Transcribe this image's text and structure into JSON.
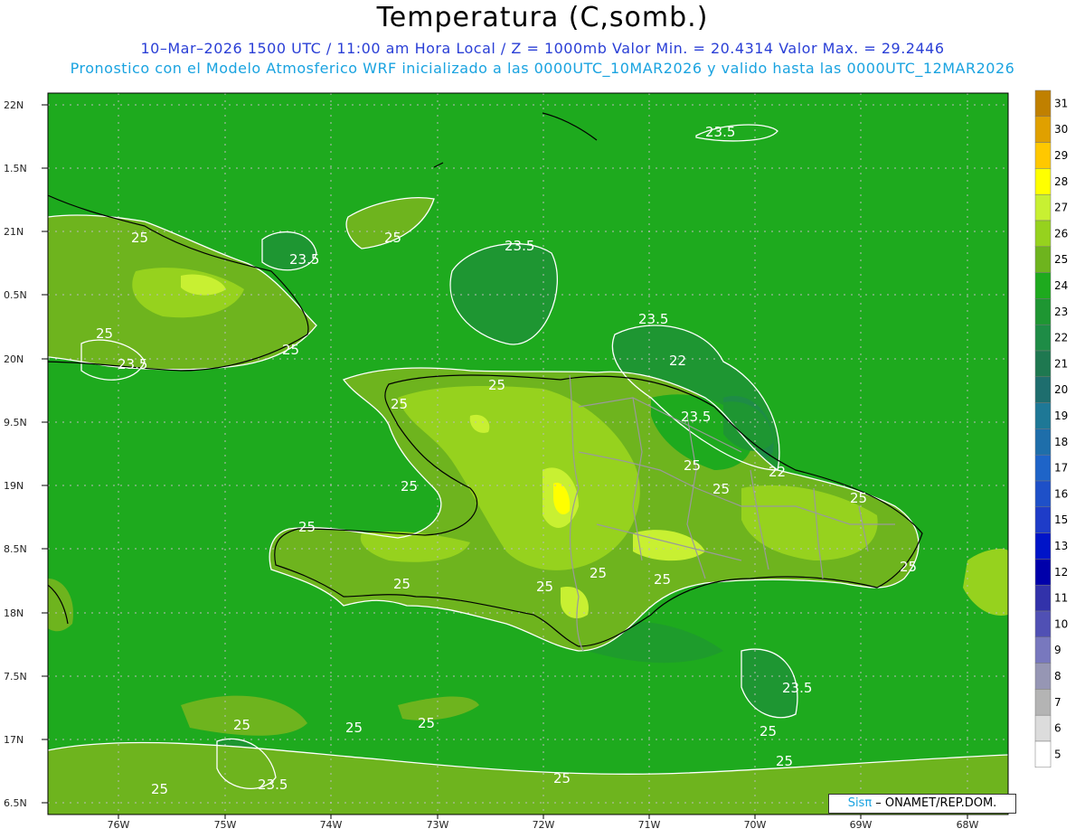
{
  "header": {
    "title": "Temperatura (C,somb.)",
    "subtitle1": "10–Mar–2026 1500 UTC / 11:00 am Hora Local / Z = 1000mb  Valor Min. = 20.4314  Valor Max. = 29.2446",
    "subtitle2": "Pronostico con el Modelo Atmosferico WRF inicializado a las 0000UTC_10MAR2026 y valido hasta las  0000UTC_12MAR2026"
  },
  "axes": {
    "lat_labels": [
      "22N",
      "1.5N",
      "21N",
      "0.5N",
      "20N",
      "9.5N",
      "19N",
      "8.5N",
      "18N",
      "7.5N",
      "17N",
      "6.5N"
    ],
    "lon_labels": [
      "76W",
      "75W",
      "74W",
      "73W",
      "72W",
      "71W",
      "70W",
      "69W",
      "68W"
    ]
  },
  "colorbar": {
    "levels": [
      31,
      30,
      29,
      28,
      27,
      26,
      25,
      24,
      23,
      22,
      21,
      20,
      19,
      18,
      17,
      16,
      15,
      13,
      12,
      11,
      10,
      9,
      8,
      7,
      6,
      5
    ],
    "colors": [
      "#c08000",
      "#e0a000",
      "#ffc800",
      "#ffff00",
      "#c8f032",
      "#96d21e",
      "#6eb41e",
      "#1eaa1e",
      "#1e9632",
      "#1e8c46",
      "#1e7850",
      "#1e6e6e",
      "#1e7896",
      "#1e6eaa",
      "#1e64c8",
      "#1e50c8",
      "#1e3cc8",
      "#0014c8",
      "#0000aa",
      "#3232aa",
      "#5050b4",
      "#7878be",
      "#9696b4",
      "#b4b4b4",
      "#dcdcdc",
      "#ffffff"
    ]
  },
  "contour_labels": [
    {
      "text": "23.5"
    },
    {
      "text": "25"
    },
    {
      "text": "23.5"
    },
    {
      "text": "25"
    },
    {
      "text": "23.5"
    },
    {
      "text": "25"
    },
    {
      "text": "23.5"
    },
    {
      "text": "23.5"
    },
    {
      "text": "25"
    },
    {
      "text": "25"
    },
    {
      "text": "22"
    },
    {
      "text": "23.5"
    },
    {
      "text": "25"
    },
    {
      "text": "22"
    },
    {
      "text": "25"
    },
    {
      "text": "25"
    },
    {
      "text": "25"
    },
    {
      "text": "25"
    },
    {
      "text": "25"
    },
    {
      "text": "25"
    },
    {
      "text": "25"
    },
    {
      "text": "25"
    },
    {
      "text": "25"
    },
    {
      "text": "23.5"
    },
    {
      "text": "25"
    },
    {
      "text": "25"
    },
    {
      "text": "25"
    },
    {
      "text": "23.5"
    },
    {
      "text": "25"
    },
    {
      "text": "25"
    },
    {
      "text": "25"
    },
    {
      "text": "25"
    },
    {
      "text": "25"
    }
  ],
  "credit": {
    "brand": "Sisπ",
    "text": " – ONAMET/REP.DOM."
  }
}
